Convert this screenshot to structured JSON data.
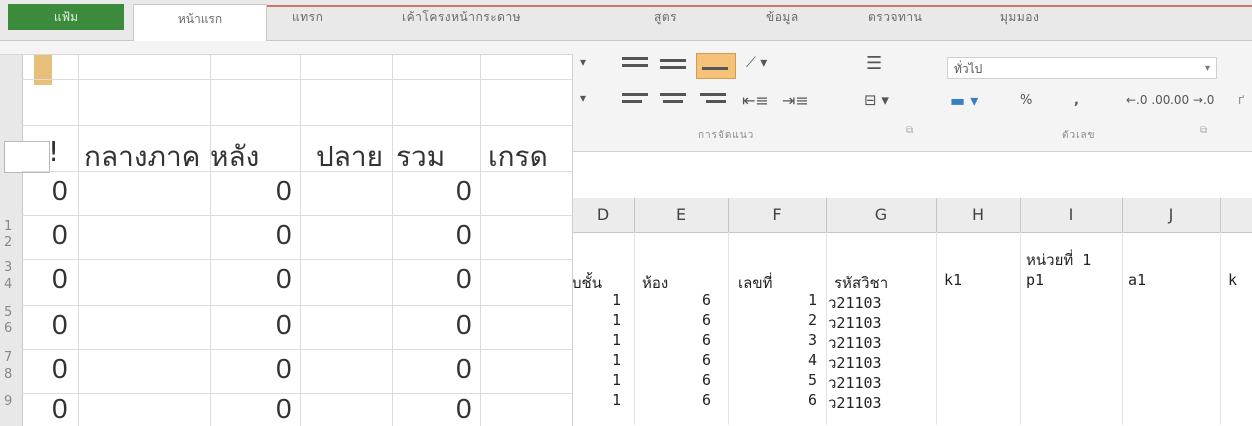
{
  "ribbon_tabs": {
    "file": "แฟ้ม",
    "home": "หน้าแรก",
    "insert": "แทรก",
    "page_layout": "เค้าโครงหน้ากระดาษ",
    "formulas": "สูตร",
    "data": "ข้อมูล",
    "review": "ตรวจทาน",
    "view": "มุมมอง"
  },
  "ribbon": {
    "alignment_group_label": "การจัดแนว",
    "number_group_label": "ตัวเลข",
    "number_format_value": "ทั่วไป",
    "percent": "%",
    "comma": ","
  },
  "spreadsheet": {
    "column_headers": [
      "D",
      "E",
      "F",
      "G",
      "H",
      "I",
      "J"
    ],
    "unit_label": "หน่วยที่ 1",
    "field_headers": [
      "บชั้น",
      "ห้อง",
      "เลขที่",
      "รหัสวิชา",
      "k1",
      "p1",
      "a1",
      "k"
    ],
    "rows": [
      {
        "grade": "1",
        "room": "6",
        "number": "1",
        "code": "ว21103"
      },
      {
        "grade": "1",
        "room": "6",
        "number": "2",
        "code": "ว21103"
      },
      {
        "grade": "1",
        "room": "6",
        "number": "3",
        "code": "ว21103"
      },
      {
        "grade": "1",
        "room": "6",
        "number": "4",
        "code": "ว21103"
      },
      {
        "grade": "1",
        "room": "6",
        "number": "5",
        "code": "ว21103"
      },
      {
        "grade": "1",
        "room": "6",
        "number": "6",
        "code": "ว21103"
      }
    ],
    "row_numbers": [
      "1",
      "2",
      "3",
      "4",
      "5",
      "6",
      "7",
      "8",
      "9"
    ]
  },
  "overlay_table": {
    "headers": [
      "!",
      "กลางภาค",
      "หลัง",
      "ปลาย",
      "รวม",
      "เกรด"
    ],
    "rows": [
      [
        "0",
        "0",
        "0"
      ],
      [
        "0",
        "0",
        "0"
      ],
      [
        "0",
        "0",
        "0"
      ],
      [
        "0",
        "0",
        "0"
      ],
      [
        "0",
        "0",
        "0"
      ],
      [
        "0",
        "0",
        "0"
      ]
    ]
  },
  "colors": {
    "file_tab": "#3c8a3c",
    "highlight_button": "#f5c27a",
    "tab_underline": "#c8786a"
  }
}
